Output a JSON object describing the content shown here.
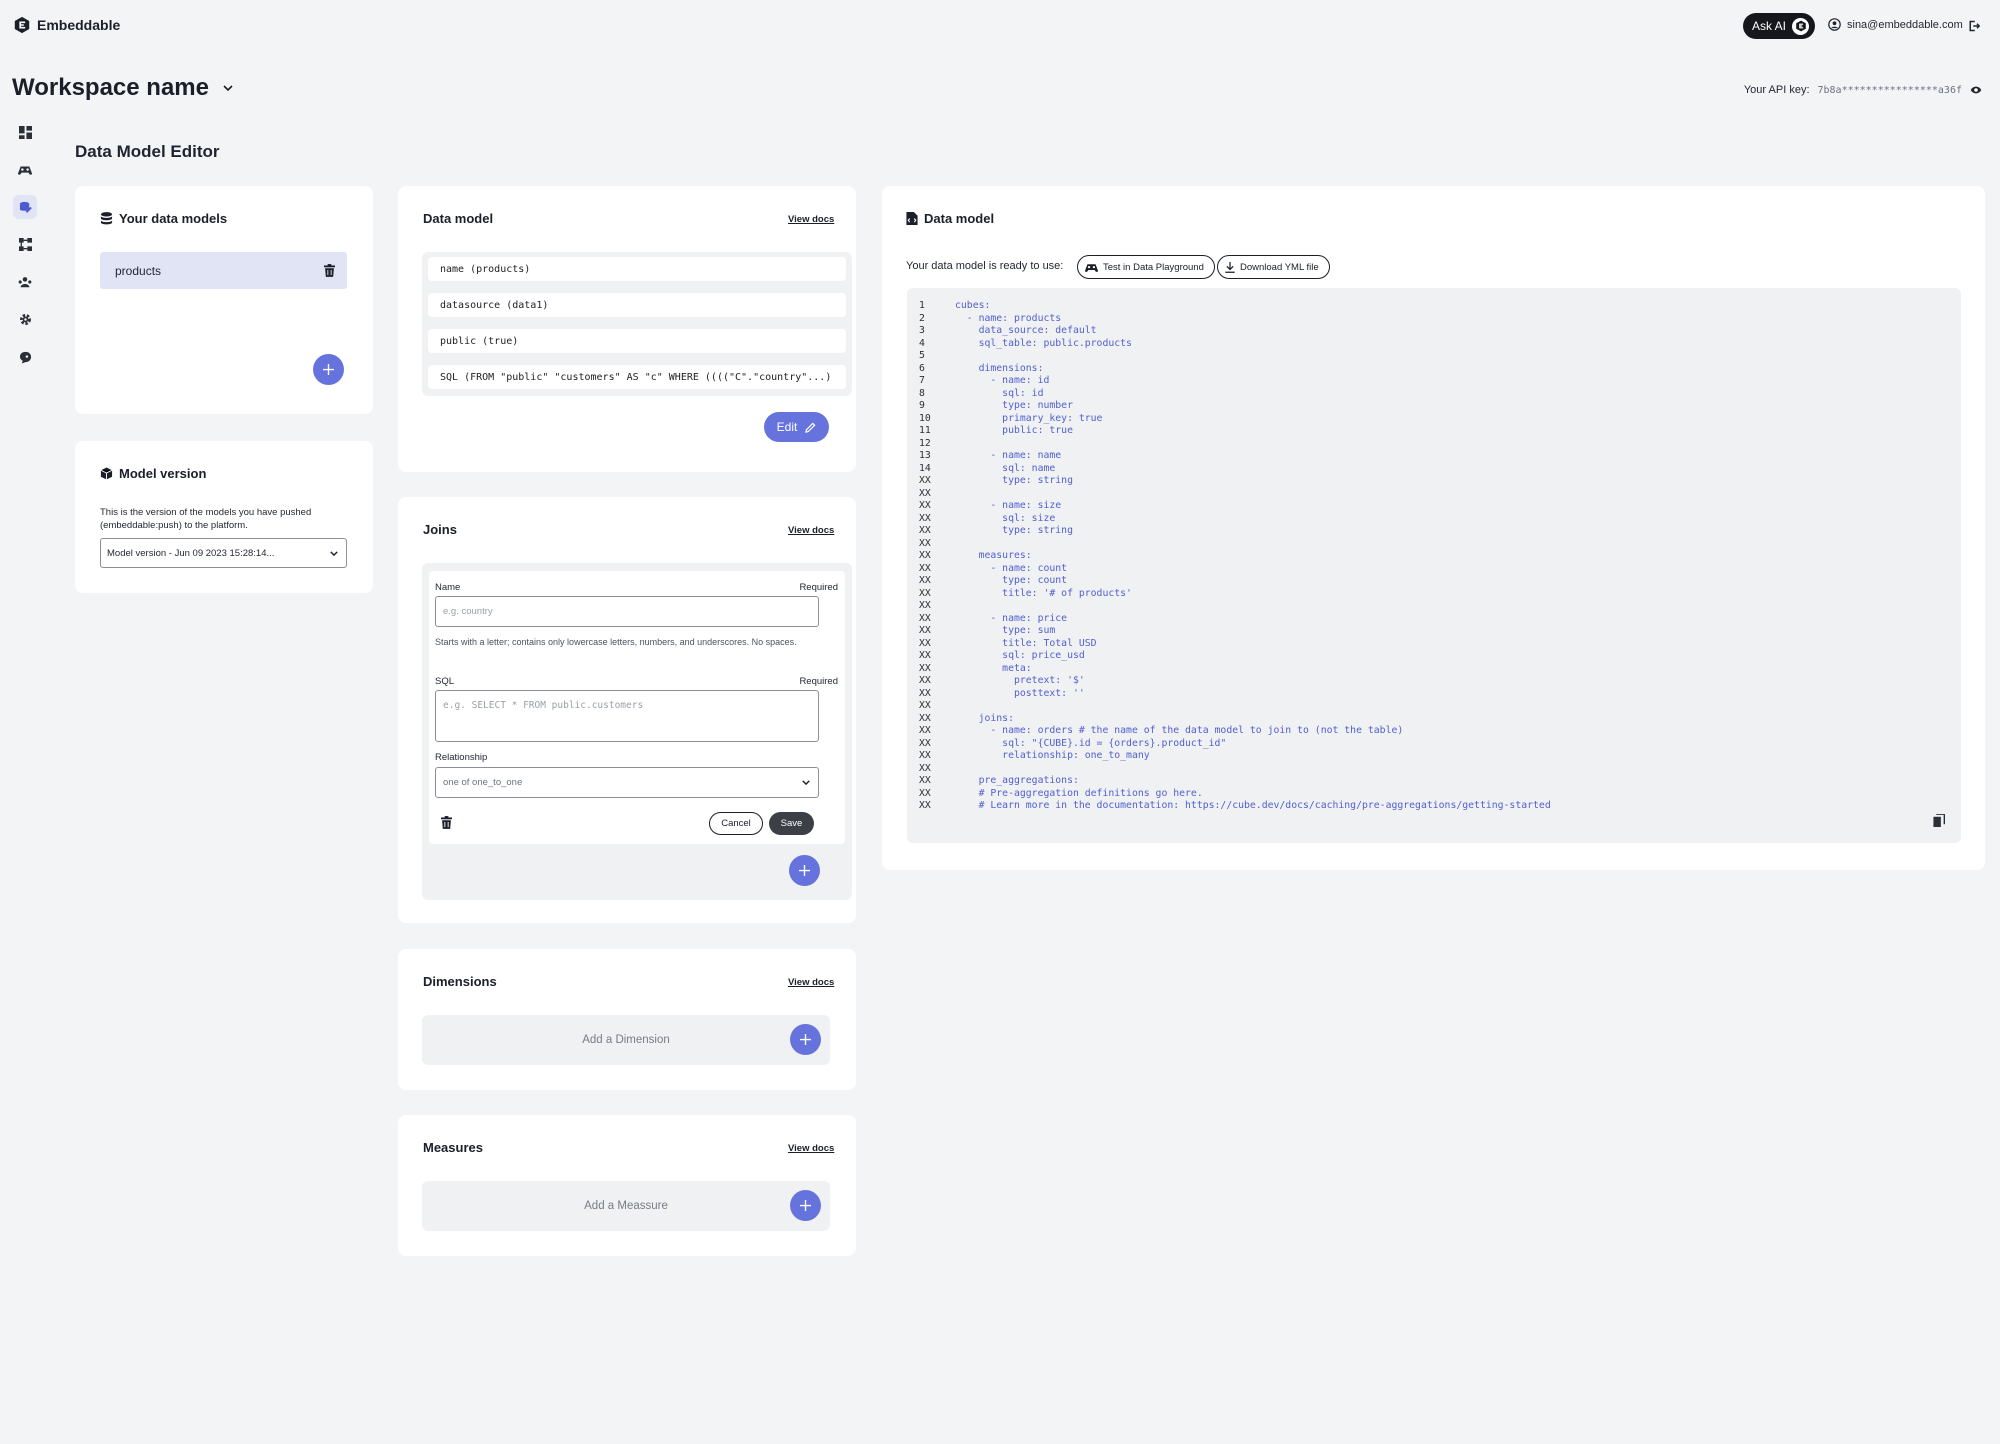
{
  "app": {
    "name": "Embeddable"
  },
  "header": {
    "ask_ai": "Ask AI",
    "user_email": "sina@embeddable.com"
  },
  "workspace": {
    "name": "Workspace name",
    "api_key_label": "Your API key:",
    "api_key": "7b8a****************a36f"
  },
  "page": {
    "title": "Data Model Editor"
  },
  "sidebar": {
    "items": [
      {
        "icon": "dashboard-icon"
      },
      {
        "icon": "playground-icon"
      },
      {
        "icon": "data-model-icon",
        "active": true
      },
      {
        "icon": "components-icon"
      },
      {
        "icon": "team-icon"
      },
      {
        "icon": "settings-icon"
      },
      {
        "icon": "support-icon"
      }
    ]
  },
  "your_models": {
    "title": "Your data models",
    "items": [
      {
        "name": "products"
      }
    ]
  },
  "model_version": {
    "title": "Model version",
    "description": "This is the version of the models you have pushed (embeddable:push) to the platform.",
    "selected": "Model version - Jun 09 2023 15:28:14..."
  },
  "data_model": {
    "title": "Data model",
    "view_docs": "View docs",
    "properties": [
      "name (products)",
      "datasource (data1)",
      "public (true)",
      "SQL (FROM \"public\" \"customers\" AS \"c\" WHERE ((((\"C\".\"country\"...)"
    ],
    "edit_label": "Edit"
  },
  "joins": {
    "title": "Joins",
    "view_docs": "View docs",
    "name_label": "Name",
    "name_required": "Required",
    "name_placeholder": "e.g. country",
    "name_hint": "Starts with a letter; contains only lowercase letters, numbers, and underscores. No spaces.",
    "sql_label": "SQL",
    "sql_required": "Required",
    "sql_placeholder": "e.g. SELECT * FROM public.customers",
    "relationship_label": "Relationship",
    "relationship_value": "one of one_to_one",
    "cancel": "Cancel",
    "save": "Save"
  },
  "dimensions": {
    "title": "Dimensions",
    "view_docs": "View docs",
    "add_label": "Add a Dimension"
  },
  "measures": {
    "title": "Measures",
    "view_docs": "View docs",
    "add_label": "Add a Meassure"
  },
  "yaml_panel": {
    "title": "Data model",
    "ready_text": "Your data model is ready to use:",
    "test_button": "Test in Data Playground",
    "download_button": "Download YML file",
    "lines": [
      {
        "n": "1",
        "t": "cubes:"
      },
      {
        "n": "2",
        "t": "  - name: products"
      },
      {
        "n": "3",
        "t": "    data_source: default"
      },
      {
        "n": "4",
        "t": "    sql_table: public.products"
      },
      {
        "n": "5",
        "t": ""
      },
      {
        "n": "6",
        "t": "    dimensions:"
      },
      {
        "n": "7",
        "t": "      - name: id"
      },
      {
        "n": "8",
        "t": "        sql: id"
      },
      {
        "n": "9",
        "t": "        type: number"
      },
      {
        "n": "10",
        "t": "        primary_key: true"
      },
      {
        "n": "11",
        "t": "        public: true"
      },
      {
        "n": "12",
        "t": ""
      },
      {
        "n": "13",
        "t": "      - name: name"
      },
      {
        "n": "14",
        "t": "        sql: name"
      },
      {
        "n": "XX",
        "t": "        type: string"
      },
      {
        "n": "XX",
        "t": ""
      },
      {
        "n": "XX",
        "t": "      - name: size"
      },
      {
        "n": "XX",
        "t": "        sql: size"
      },
      {
        "n": "XX",
        "t": "        type: string"
      },
      {
        "n": "XX",
        "t": ""
      },
      {
        "n": "XX",
        "t": "    measures:"
      },
      {
        "n": "XX",
        "t": "      - name: count"
      },
      {
        "n": "XX",
        "t": "        type: count"
      },
      {
        "n": "XX",
        "t": "        title: '# of products'"
      },
      {
        "n": "XX",
        "t": ""
      },
      {
        "n": "XX",
        "t": "      - name: price"
      },
      {
        "n": "XX",
        "t": "        type: sum"
      },
      {
        "n": "XX",
        "t": "        title: Total USD"
      },
      {
        "n": "XX",
        "t": "        sql: price_usd"
      },
      {
        "n": "XX",
        "t": "        meta:"
      },
      {
        "n": "XX",
        "t": "          pretext: '$'"
      },
      {
        "n": "XX",
        "t": "          posttext: ''"
      },
      {
        "n": "XX",
        "t": ""
      },
      {
        "n": "XX",
        "t": "    joins:"
      },
      {
        "n": "XX",
        "t": "      - name: orders # the name of the data model to join to (not the table)"
      },
      {
        "n": "XX",
        "t": "        sql: \"{CUBE}.id = {orders}.product_id\""
      },
      {
        "n": "XX",
        "t": "        relationship: one_to_many"
      },
      {
        "n": "XX",
        "t": ""
      },
      {
        "n": "XX",
        "t": "    pre_aggregations:"
      },
      {
        "n": "XX",
        "t": "    # Pre-aggregation definitions go here."
      },
      {
        "n": "XX",
        "t": "    # Learn more in the documentation: https://cube.dev/docs/caching/pre-aggregations/getting-started"
      }
    ]
  },
  "colors": {
    "accent": "#6673dd",
    "active_bg": "#e1e4f5",
    "code_text": "#5260d0"
  }
}
